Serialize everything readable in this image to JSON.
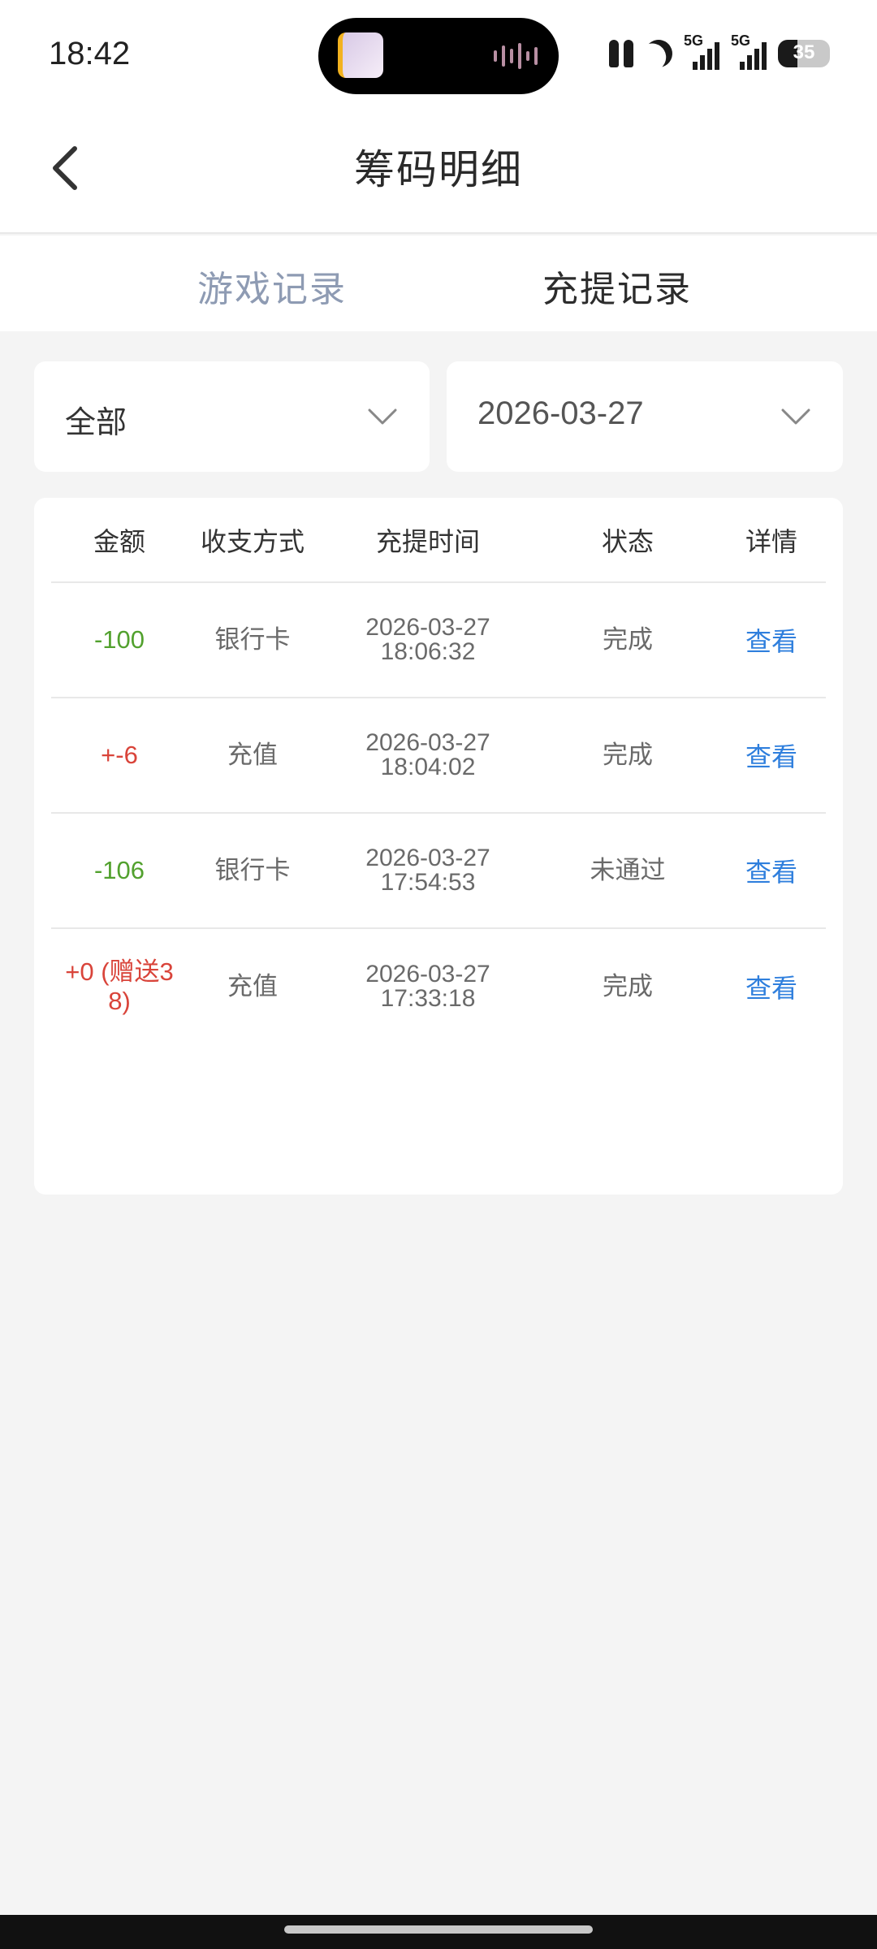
{
  "status_bar": {
    "time": "18:42",
    "signal_1_label": "5G",
    "signal_2_label": "5G",
    "battery_level": "35",
    "icons": [
      "earbuds-icon",
      "moon-icon",
      "signal-icon",
      "battery-icon"
    ]
  },
  "header": {
    "title": "筹码明细",
    "back_icon": "chevron-left-icon"
  },
  "tabs": [
    {
      "label": "游戏记录",
      "active": false
    },
    {
      "label": "充提记录",
      "active": true
    }
  ],
  "filters": {
    "type": {
      "value": "全部",
      "icon": "chevron-down-icon"
    },
    "date": {
      "value": "2026-03-27",
      "icon": "chevron-down-icon"
    }
  },
  "table": {
    "columns": [
      "金额",
      "收支方式",
      "充提时间",
      "状态",
      "详情"
    ],
    "rows": [
      {
        "amount": "-100",
        "method": "银行卡",
        "date": "2026-03-27",
        "time": "18:06:32",
        "status": "完成",
        "detail": "查看"
      },
      {
        "amount": "+-6",
        "method": "充值",
        "date": "2026-03-27",
        "time": "18:04:02",
        "status": "完成",
        "detail": "查看"
      },
      {
        "amount": "-106",
        "method": "银行卡",
        "date": "2026-03-27",
        "time": "17:54:53",
        "status": "未通过",
        "detail": "查看"
      },
      {
        "amount": "+0 (赠送38)",
        "amount_line1": "+0 (赠送3",
        "amount_line2": "8)",
        "method": "充值",
        "date": "2026-03-27",
        "time": "17:33:18",
        "status": "完成",
        "detail": "查看"
      }
    ]
  },
  "colors": {
    "negative_amount": "#52a12e",
    "positive_amount": "#d9443a",
    "link": "#2f7fdd",
    "inactive_tab": "#8e9bb3"
  }
}
